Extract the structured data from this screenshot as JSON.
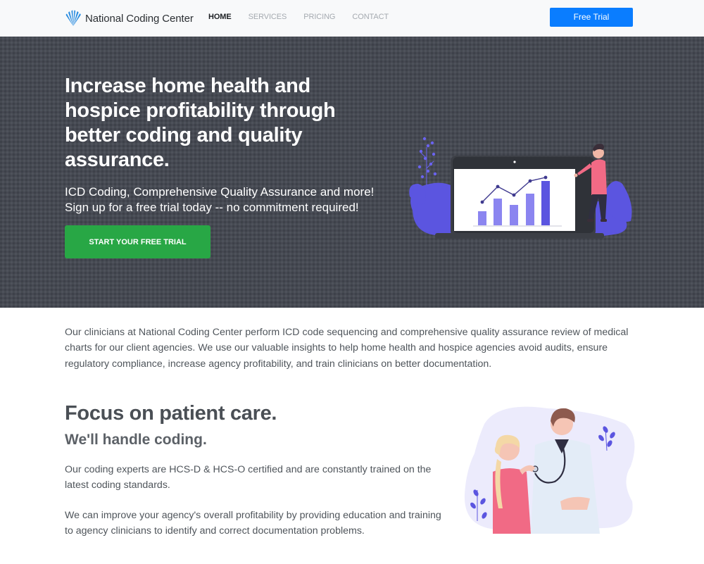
{
  "navbar": {
    "brand_name": "National Coding Center",
    "links": [
      "HOME",
      "SERVICES",
      "PRICING",
      "CONTACT"
    ],
    "active_link": "HOME",
    "cta_label": "Free Trial"
  },
  "hero": {
    "title": "Increase home health and hospice profitability through better coding and quality assurance.",
    "subtitle_line1": "ICD Coding, Comprehensive Quality Assurance and more!",
    "subtitle_line2": "Sign up for a free trial today -- no commitment required!",
    "button_label": "START YOUR FREE TRIAL",
    "illustration_icon": "presentation-chart-illustration"
  },
  "intro": {
    "text": "Our clinicians at National Coding Center perform ICD code sequencing and comprehensive quality assurance review of medical charts for our client agencies. We use our valuable insights to help home health and hospice agencies avoid audits, ensure regulatory compliance, increase agency profitability, and train clinicians on better documentation."
  },
  "feature": {
    "title": "Focus on patient care.",
    "subtitle": "We'll handle coding.",
    "paragraph1": "Our coding experts are HCS-D & HCS-O certified and are constantly trained on the latest coding standards.",
    "paragraph2": "We can improve your agency's overall profitability by providing education and training to agency clinicians to identify and correct documentation problems.",
    "illustration_icon": "doctor-patient-illustration"
  },
  "colors": {
    "brand_blue": "#0a7dff",
    "cta_green": "#28a745",
    "hero_bg": "#474b55",
    "illustration_purple": "#5b55e0"
  }
}
